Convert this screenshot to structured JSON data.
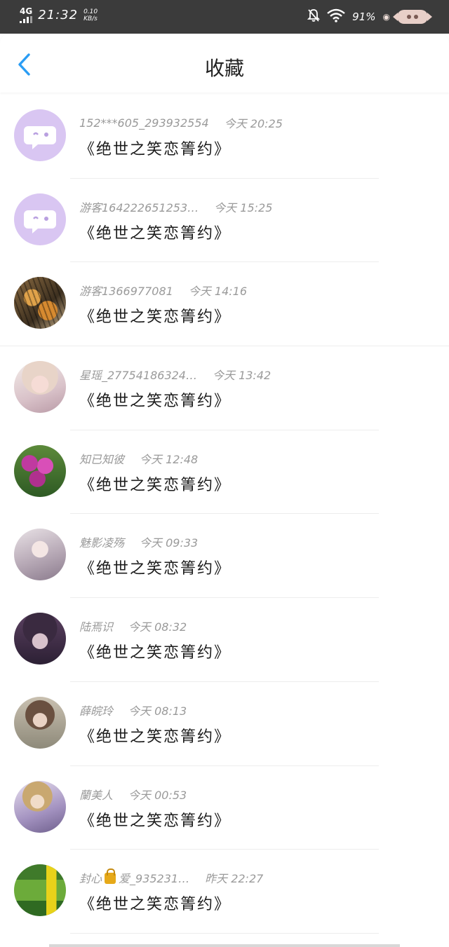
{
  "status_bar": {
    "network": "4G",
    "time": "21:32",
    "speed_value": "0.10",
    "speed_unit": "KB/s",
    "battery": "91%"
  },
  "header": {
    "back_icon": "chevron-left-icon",
    "title": "收藏"
  },
  "items": [
    {
      "name": "152***605_293932554",
      "time": "今天 20:25",
      "title": "《绝世之笑恋箐约》",
      "avatar": "chat-bubble-icon"
    },
    {
      "name": "游客164222651253…",
      "time": "今天 15:25",
      "title": "《绝世之笑恋箐约》",
      "avatar": "chat-bubble-icon"
    },
    {
      "name": "游客1366977081",
      "time": "今天 14:16",
      "title": "《绝世之笑恋箐约》",
      "avatar": "tiger-photo"
    },
    {
      "name": "星瑶_27754186324…",
      "time": "今天 13:42",
      "title": "《绝世之笑恋箐约》",
      "avatar": "anime-girl-photo"
    },
    {
      "name": "知已知彼",
      "time": "今天 12:48",
      "title": "《绝世之笑恋箐约》",
      "avatar": "flowers-photo"
    },
    {
      "name": "魅影凌殇",
      "time": "今天 09:33",
      "title": "《绝世之笑恋箐约》",
      "avatar": "anime-girl-photo"
    },
    {
      "name": "陆焉识",
      "time": "今天 08:32",
      "title": "《绝世之笑恋箐约》",
      "avatar": "anime-boy-photo"
    },
    {
      "name": "薛皖玲",
      "time": "今天 08:13",
      "title": "《绝世之笑恋箐约》",
      "avatar": "girl-photo"
    },
    {
      "name": "蘭美人",
      "time": "今天 00:53",
      "title": "《绝世之笑恋箐约》",
      "avatar": "anime-man-photo"
    },
    {
      "name_prefix": "封心",
      "name_suffix": "爱_935231…",
      "time": "昨天 22:27",
      "title": "《绝世之笑恋箐约》",
      "avatar": "sign-photo"
    }
  ],
  "colors": {
    "accent": "#2a9df4",
    "avatar_placeholder": "#d9c6f2"
  }
}
